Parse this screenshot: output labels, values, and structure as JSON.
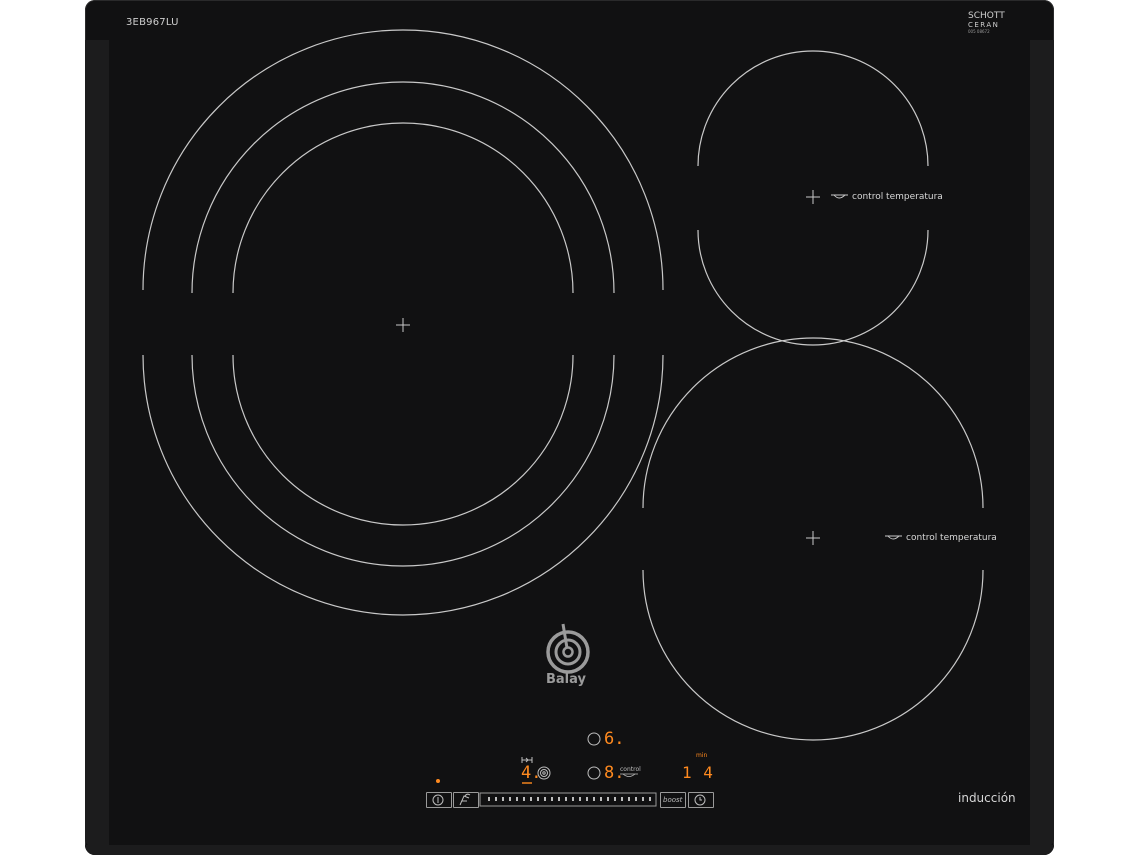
{
  "product": {
    "model": "3EB967LU",
    "glass_brand_line1": "SCHOTT",
    "glass_brand_line2": "CERAN",
    "glass_code": "005 08672",
    "brand": "Balay",
    "type_label": "inducción"
  },
  "zones": {
    "large": {},
    "top_right": {
      "label": "control temperatura"
    },
    "bottom_right": {
      "label": "control temperatura"
    }
  },
  "controls": {
    "display_top": "6.",
    "display_left": "4.",
    "display_middle": "8.",
    "middle_label": "control",
    "timer_unit": "min",
    "timer_value": "1 4",
    "boost_label": "boost",
    "slider_value": 0
  },
  "colors": {
    "glass": "#111112",
    "lines": "#c9c9c9",
    "display": "#ff8a1f",
    "logo": "#9b9b9b"
  }
}
